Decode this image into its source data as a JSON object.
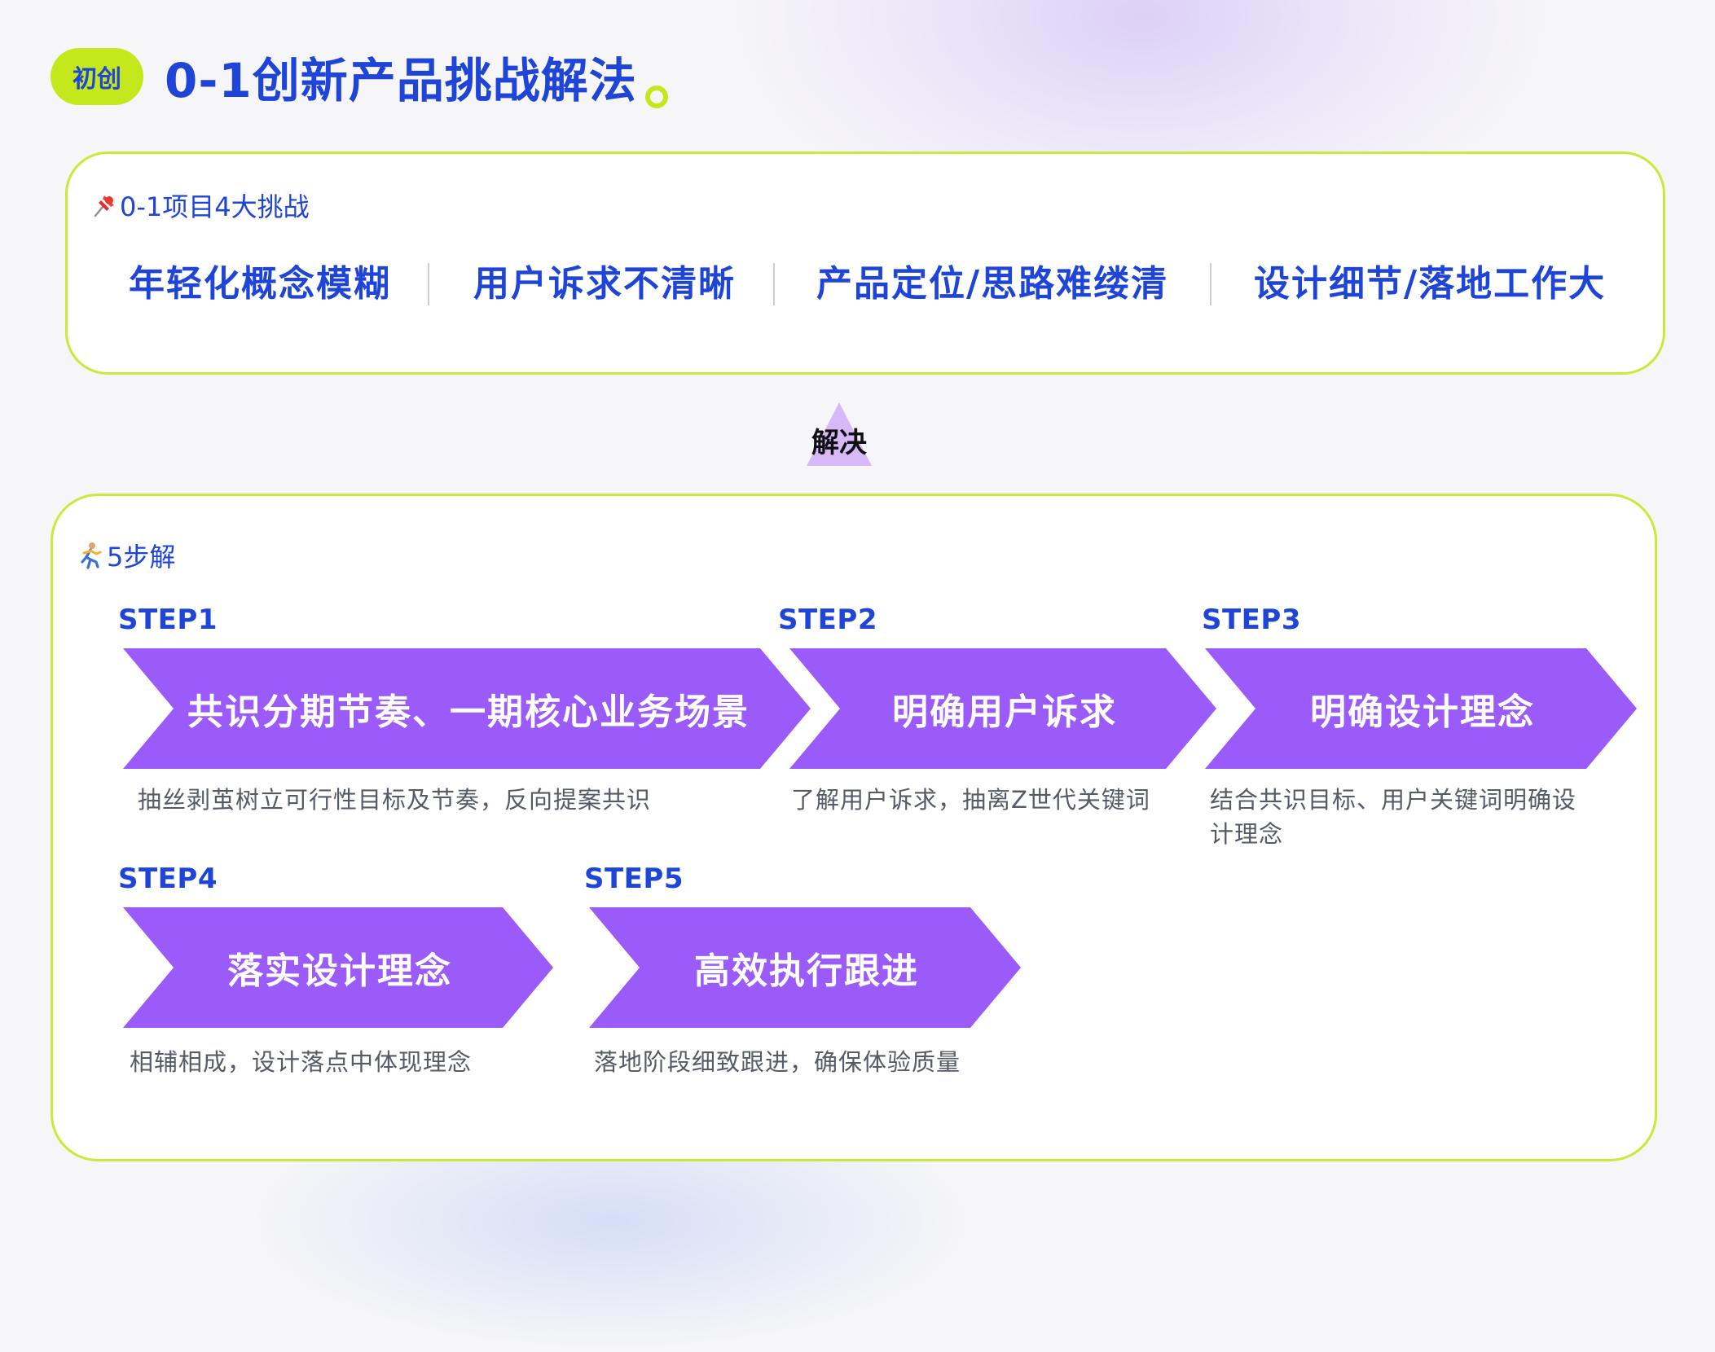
{
  "header": {
    "badge": "初创",
    "title": "0-1创新产品挑战解法"
  },
  "challenges": {
    "heading_icon": "pushpin-icon",
    "heading": "0-1项目4大挑战",
    "items": [
      "年轻化概念模糊",
      "用户诉求不清晰",
      "产品定位/思路难缕清",
      "设计细节/落地工作大"
    ]
  },
  "resolve": {
    "label": "解决"
  },
  "solution": {
    "heading_icon": "runner-icon",
    "heading": "5步解",
    "steps": [
      {
        "label": "STEP1",
        "title": "共识分期节奏、一期核心业务场景",
        "desc": "抽丝剥茧树立可行性目标及节奏，反向提案共识"
      },
      {
        "label": "STEP2",
        "title": "明确用户诉求",
        "desc": "了解用户诉求，抽离Z世代关键词"
      },
      {
        "label": "STEP3",
        "title": "明确设计理念",
        "desc": "结合共识目标、用户关键词明确设计理念"
      },
      {
        "label": "STEP4",
        "title": "落实设计理念",
        "desc": "相辅相成，设计落点中体现理念"
      },
      {
        "label": "STEP5",
        "title": "高效执行跟进",
        "desc": "落地阶段细致跟进，确保体验质量"
      }
    ]
  },
  "colors": {
    "primary_blue": "#1f45d8",
    "accent_lime": "#c4e81c",
    "chevron_purple": "#9b5afa",
    "resolve_lilac": "#d7b8f8"
  }
}
